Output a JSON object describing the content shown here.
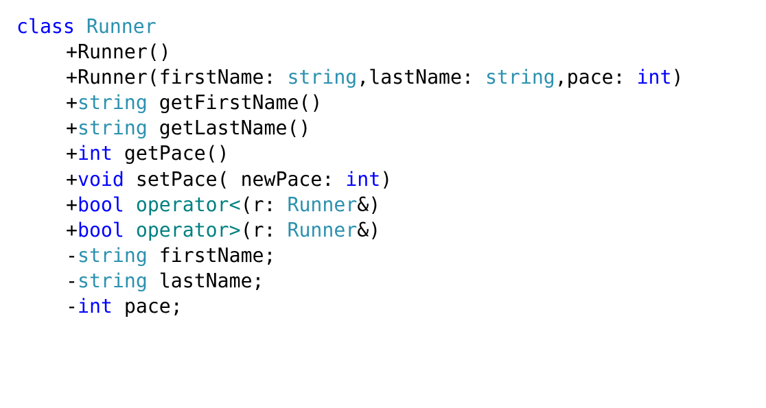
{
  "code_lines": [
    {
      "tokens": [
        {
          "text": "class",
          "kind": "kw"
        },
        {
          "text": " ",
          "kind": "plain"
        },
        {
          "text": "Runner",
          "kind": "type"
        }
      ],
      "indent": false
    },
    {
      "tokens": [
        {
          "text": "+Runner()",
          "kind": "plain"
        }
      ],
      "indent": true
    },
    {
      "tokens": [
        {
          "text": "+Runner(firstName: ",
          "kind": "plain"
        },
        {
          "text": "string",
          "kind": "type"
        },
        {
          "text": ",lastName: ",
          "kind": "plain"
        },
        {
          "text": "string",
          "kind": "type"
        },
        {
          "text": ",pace: ",
          "kind": "plain"
        },
        {
          "text": "int",
          "kind": "kw"
        },
        {
          "text": ")",
          "kind": "plain"
        }
      ],
      "indent": true
    },
    {
      "tokens": [
        {
          "text": "+",
          "kind": "plain"
        },
        {
          "text": "string",
          "kind": "type"
        },
        {
          "text": " getFirstName()",
          "kind": "plain"
        }
      ],
      "indent": true
    },
    {
      "tokens": [
        {
          "text": "+",
          "kind": "plain"
        },
        {
          "text": "string",
          "kind": "type"
        },
        {
          "text": " getLastName()",
          "kind": "plain"
        }
      ],
      "indent": true
    },
    {
      "tokens": [
        {
          "text": "+",
          "kind": "plain"
        },
        {
          "text": "int",
          "kind": "kw"
        },
        {
          "text": " getPace()",
          "kind": "plain"
        }
      ],
      "indent": true
    },
    {
      "tokens": [
        {
          "text": "+",
          "kind": "plain"
        },
        {
          "text": "void",
          "kind": "kw"
        },
        {
          "text": " setPace( newPace: ",
          "kind": "plain"
        },
        {
          "text": "int",
          "kind": "kw"
        },
        {
          "text": ")",
          "kind": "plain"
        }
      ],
      "indent": true
    },
    {
      "tokens": [
        {
          "text": "+",
          "kind": "plain"
        },
        {
          "text": "bool",
          "kind": "kw"
        },
        {
          "text": " ",
          "kind": "plain"
        },
        {
          "text": "operator<",
          "kind": "op"
        },
        {
          "text": "(r: ",
          "kind": "plain"
        },
        {
          "text": "Runner",
          "kind": "type"
        },
        {
          "text": "&)",
          "kind": "plain"
        }
      ],
      "indent": true
    },
    {
      "tokens": [
        {
          "text": "+",
          "kind": "plain"
        },
        {
          "text": "bool",
          "kind": "kw"
        },
        {
          "text": " ",
          "kind": "plain"
        },
        {
          "text": "operator>",
          "kind": "op"
        },
        {
          "text": "(r: ",
          "kind": "plain"
        },
        {
          "text": "Runner",
          "kind": "type"
        },
        {
          "text": "&)",
          "kind": "plain"
        }
      ],
      "indent": true
    },
    {
      "tokens": [
        {
          "text": "-",
          "kind": "plain"
        },
        {
          "text": "string",
          "kind": "type"
        },
        {
          "text": " firstName;",
          "kind": "plain"
        }
      ],
      "indent": true
    },
    {
      "tokens": [
        {
          "text": "-",
          "kind": "plain"
        },
        {
          "text": "string",
          "kind": "type"
        },
        {
          "text": " lastName;",
          "kind": "plain"
        }
      ],
      "indent": true
    },
    {
      "tokens": [
        {
          "text": "-",
          "kind": "plain"
        },
        {
          "text": "int",
          "kind": "kw"
        },
        {
          "text": " pace;",
          "kind": "plain"
        }
      ],
      "indent": true
    }
  ],
  "colors": {
    "keyword": "#0000ff",
    "type": "#2b91af",
    "operator": "#008080",
    "plain": "#000000",
    "background": "#ffffff"
  }
}
